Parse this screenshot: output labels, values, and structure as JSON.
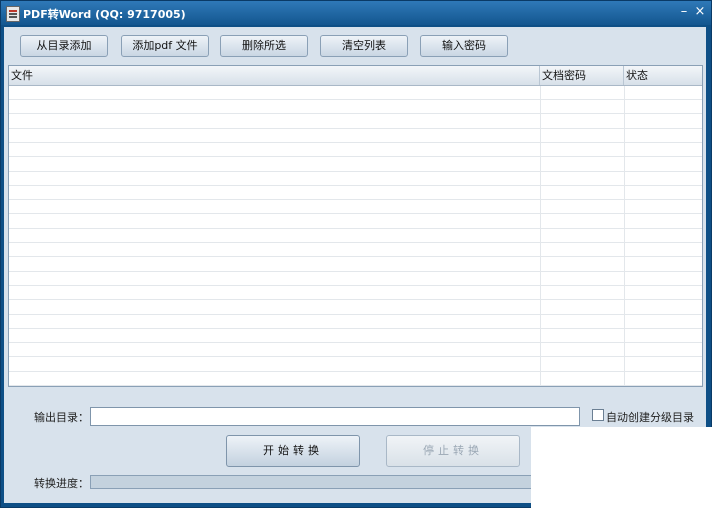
{
  "window": {
    "title": "PDF转Word (QQ: 9717005)",
    "minimize": "–",
    "close": "×"
  },
  "toolbar": {
    "add_from_dir": "从目录添加",
    "add_pdf": "添加pdf 文件",
    "delete_selected": "删除所选",
    "clear_list": "清空列表",
    "enter_password": "输入密码"
  },
  "file_list": {
    "columns": {
      "file": "文件",
      "password": "文档密码",
      "status": "状态"
    }
  },
  "output": {
    "label": "输出目录：",
    "value": "",
    "auto_create_label": "自动创建分级目录"
  },
  "actions": {
    "start": "开始转换",
    "stop": "停止转换"
  },
  "progress": {
    "label": "转换进度：",
    "value": 0
  }
}
